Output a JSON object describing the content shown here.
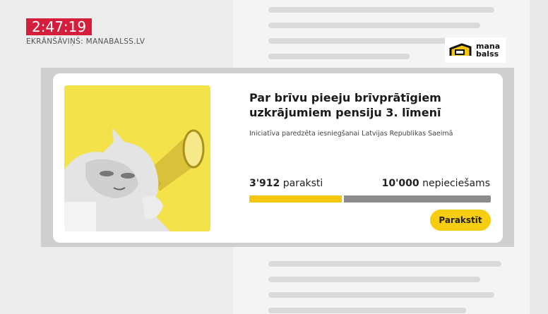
{
  "overlay": {
    "time": "2:47:19",
    "credit": "EKRĀNŠĀVIŅŠ: MANABALSS.LV"
  },
  "logo": {
    "text_line1": "mana",
    "text_line2": "balss"
  },
  "initiative": {
    "title": "Par brīvu pieeju brīvprātīgiem uzkrājumiem pensiju 3. līmenī",
    "subtitle": "Iniciatīva paredzēta iesniegšanai Latvijas Republikas Saeimā",
    "signatures_count": "3'912",
    "signatures_label": "paraksti",
    "required_count": "10'000",
    "required_label": "nepieciešams",
    "progress_fraction": 0.3912,
    "sign_button": "Parakstīt"
  },
  "colors": {
    "accent_yellow": "#f6c60f",
    "progress_track": "#8c8c8c",
    "timestamp_red": "#d41e3c"
  }
}
